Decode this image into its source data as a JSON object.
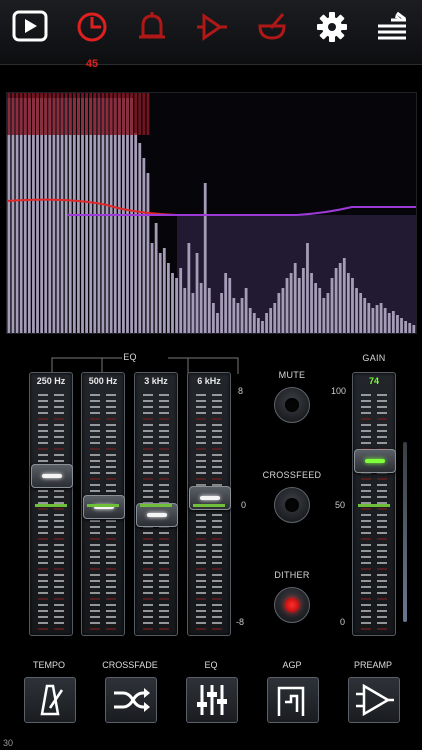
{
  "toolbar": {
    "items": [
      {
        "name": "play",
        "icon": "play-icon",
        "color": "#ffffff"
      },
      {
        "name": "timer",
        "icon": "timer-icon",
        "color": "#e02020",
        "badge": "45"
      },
      {
        "name": "alarm",
        "icon": "bell-icon",
        "color": "#b01818"
      },
      {
        "name": "route",
        "icon": "arrow-right-icon",
        "color": "#b01818"
      },
      {
        "name": "mortar",
        "icon": "bowl-icon",
        "color": "#b01818"
      },
      {
        "name": "settings",
        "icon": "gear-icon",
        "color": "#ffffff"
      },
      {
        "name": "playlist",
        "icon": "playlist-icon",
        "color": "#ffffff"
      }
    ]
  },
  "eq": {
    "label": "EQ",
    "bands": [
      {
        "label": "250 Hz",
        "level": 0.33
      },
      {
        "label": "500 Hz",
        "level": 0.47
      },
      {
        "label": "3 kHz",
        "level": 0.51
      },
      {
        "label": "6 kHz",
        "level": 0.43
      }
    ],
    "scale": {
      "top": "8",
      "mid": "0",
      "bottom": "-8"
    }
  },
  "controls": {
    "mute": "MUTE",
    "crossfeed": "CROSSFEED",
    "dither": "DITHER"
  },
  "gain": {
    "label": "GAIN",
    "value": "74",
    "level": 0.26,
    "scale": {
      "top": "100",
      "mid": "50",
      "bottom": "0"
    }
  },
  "bottom": {
    "tempo": "TEMPO",
    "crossfade": "CROSSFADE",
    "eq": "EQ",
    "agp": "AGP",
    "preamp": "PREAMP"
  },
  "status": {
    "corner": "30"
  },
  "colors": {
    "accent_red": "#e02020",
    "spectrum_fill": "#a59cb8",
    "curve_red": "#e02828",
    "curve_purple": "#9b3ad6"
  }
}
